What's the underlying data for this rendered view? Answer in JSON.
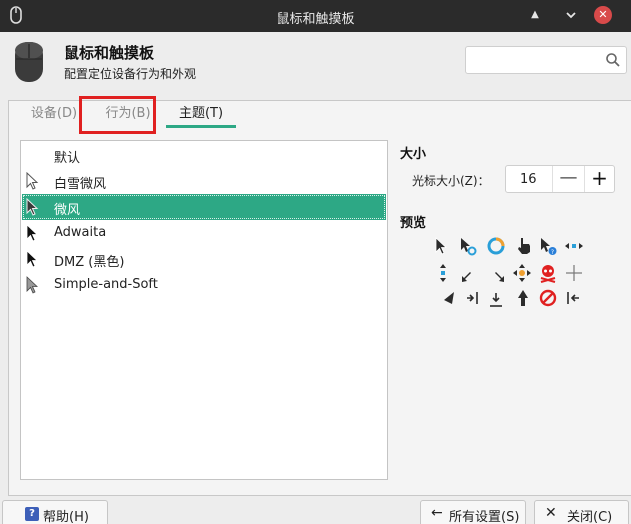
{
  "window": {
    "title": "鼠标和触摸板"
  },
  "header": {
    "title": "鼠标和触摸板",
    "subtitle": "配置定位设备行为和外观",
    "search_placeholder": ""
  },
  "tabs": [
    {
      "label": "设备(D)",
      "active": false
    },
    {
      "label": "行为(B)",
      "active": false
    },
    {
      "label": "主题(T)",
      "active": true
    }
  ],
  "themes": [
    {
      "label": "默认",
      "icon": "none",
      "selected": false
    },
    {
      "label": "白雪微风",
      "icon": "white-arrow-icon",
      "selected": false
    },
    {
      "label": "微风",
      "icon": "dark-arrow-icon",
      "selected": true
    },
    {
      "label": "Adwaita",
      "icon": "black-arrow-icon",
      "selected": false
    },
    {
      "label": "DMZ (黑色)",
      "icon": "black-arrow-icon",
      "selected": false
    },
    {
      "label": "Simple-and-Soft",
      "icon": "gray-arrow-icon",
      "selected": false
    }
  ],
  "size": {
    "section_title": "大小",
    "label": "光标大小(Z)：",
    "value": "16",
    "minus": "—",
    "plus": "+"
  },
  "preview": {
    "section_title": "预览"
  },
  "buttons": {
    "help": "帮助(H)",
    "all_settings": "所有设置(S)",
    "close": "关闭(C)"
  },
  "colors": {
    "accent": "#2da885",
    "titlebar": "#2b2b2b",
    "annotation": "#e02020",
    "close_button": "#d84a4a"
  }
}
